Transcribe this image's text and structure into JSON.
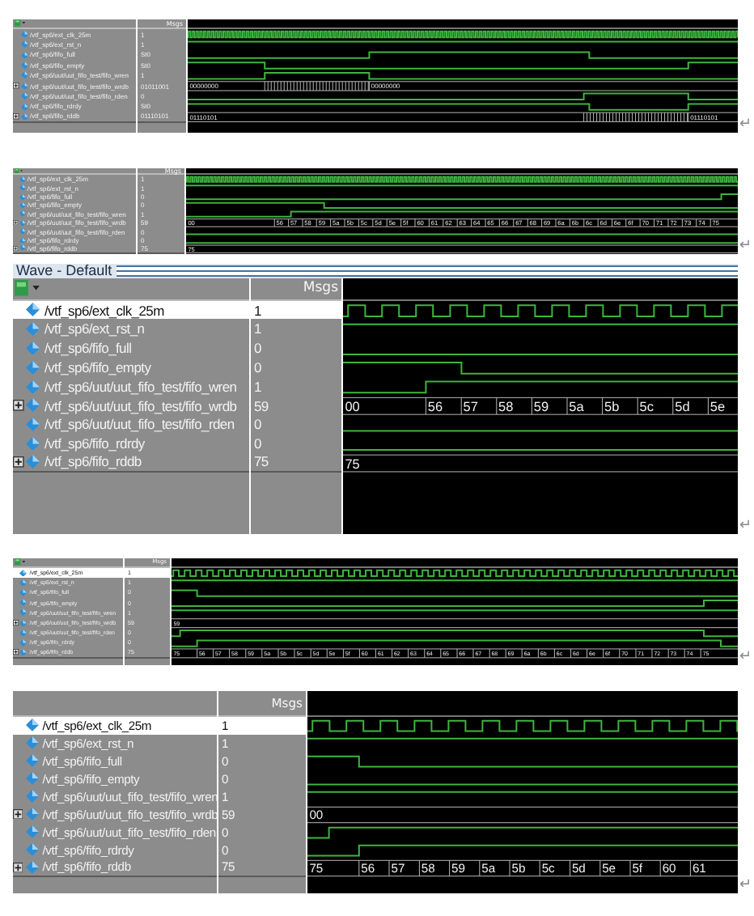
{
  "panels": [
    {
      "msgs_header": "Msgs",
      "paragraph_mark": "↵",
      "signals": [
        {
          "name": "/vtf_sp6/ext_clk_25m",
          "value": "1",
          "kind": "clock",
          "selected": false
        },
        {
          "name": "/vtf_sp6/ext_rst_n",
          "value": "1",
          "kind": "level",
          "selected": false
        },
        {
          "name": "/vtf_sp6/fifo_full",
          "value": "St0",
          "kind": "level",
          "selected": false
        },
        {
          "name": "/vtf_sp6/fifo_empty",
          "value": "St0",
          "kind": "level",
          "selected": false
        },
        {
          "name": "/vtf_sp6/uut/uut_fifo_test/fifo_wren",
          "value": "1",
          "kind": "level",
          "selected": false
        },
        {
          "name": "/vtf_sp6/uut/uut_fifo_test/fifo_wrdb",
          "value": "01011001",
          "kind": "bus",
          "selected": false,
          "bus_values": [
            "00000000",
            "00000000"
          ]
        },
        {
          "name": "/vtf_sp6/uut/uut_fifo_test/fifo_rden",
          "value": "0",
          "kind": "level",
          "selected": false
        },
        {
          "name": "/vtf_sp6/fifo_rdrdy",
          "value": "St0",
          "kind": "level",
          "selected": false
        },
        {
          "name": "/vtf_sp6/fifo_rddb",
          "value": "01110101",
          "kind": "bus",
          "selected": false,
          "bus_values": [
            "01110101",
            "01110101"
          ]
        }
      ]
    },
    {
      "msgs_header": "Msgs",
      "paragraph_mark": "↵",
      "signals": [
        {
          "name": "/vtf_sp6/ext_clk_25m",
          "value": "1",
          "kind": "clock",
          "selected": false
        },
        {
          "name": "/vtf_sp6/ext_rst_n",
          "value": "1",
          "kind": "level",
          "selected": false
        },
        {
          "name": "/vtf_sp6/fifo_full",
          "value": "0",
          "kind": "level",
          "selected": false
        },
        {
          "name": "/vtf_sp6/fifo_empty",
          "value": "0",
          "kind": "level",
          "selected": false
        },
        {
          "name": "/vtf_sp6/uut/uut_fifo_test/fifo_wren",
          "value": "1",
          "kind": "level",
          "selected": false
        },
        {
          "name": "/vtf_sp6/uut/uut_fifo_test/fifo_wrdb",
          "value": "59",
          "kind": "bus",
          "selected": false,
          "bus_values": [
            "00",
            "56",
            "57",
            "58",
            "59",
            "5a",
            "5b",
            "5c",
            "5d",
            "5e",
            "5f",
            "60",
            "61",
            "62",
            "63",
            "64",
            "65",
            "66",
            "67",
            "68",
            "69",
            "6a",
            "6b",
            "6c",
            "6d",
            "6e",
            "6f",
            "70",
            "71",
            "72",
            "73",
            "74",
            "75"
          ]
        },
        {
          "name": "/vtf_sp6/uut/uut_fifo_test/fifo_rden",
          "value": "0",
          "kind": "level",
          "selected": false
        },
        {
          "name": "/vtf_sp6/fifo_rdrdy",
          "value": "0",
          "kind": "level",
          "selected": false
        },
        {
          "name": "/vtf_sp6/fifo_rddb",
          "value": "75",
          "kind": "bus",
          "selected": false,
          "bus_values": [
            "75"
          ]
        }
      ]
    },
    {
      "title": "Wave - Default",
      "msgs_header": "Msgs",
      "paragraph_mark": "↵",
      "signals": [
        {
          "name": "/vtf_sp6/ext_clk_25m",
          "value": "1",
          "kind": "clock",
          "selected": true
        },
        {
          "name": "/vtf_sp6/ext_rst_n",
          "value": "1",
          "kind": "level",
          "selected": false
        },
        {
          "name": "/vtf_sp6/fifo_full",
          "value": "0",
          "kind": "level",
          "selected": false
        },
        {
          "name": "/vtf_sp6/fifo_empty",
          "value": "0",
          "kind": "level",
          "selected": false
        },
        {
          "name": "/vtf_sp6/uut/uut_fifo_test/fifo_wren",
          "value": "1",
          "kind": "level",
          "selected": false
        },
        {
          "name": "/vtf_sp6/uut/uut_fifo_test/fifo_wrdb",
          "value": "59",
          "kind": "bus",
          "selected": false,
          "bus_values": [
            "00",
            "56",
            "57",
            "58",
            "59",
            "5a",
            "5b",
            "5c",
            "5d",
            "5e"
          ]
        },
        {
          "name": "/vtf_sp6/uut/uut_fifo_test/fifo_rden",
          "value": "0",
          "kind": "level",
          "selected": false
        },
        {
          "name": "/vtf_sp6/fifo_rdrdy",
          "value": "0",
          "kind": "level",
          "selected": false
        },
        {
          "name": "/vtf_sp6/fifo_rddb",
          "value": "75",
          "kind": "bus",
          "selected": false,
          "bus_values": [
            "75"
          ]
        }
      ]
    },
    {
      "msgs_header": "Msgs",
      "paragraph_mark": "↵",
      "signals": [
        {
          "name": "/vtf_sp6/ext_clk_25m",
          "value": "1",
          "kind": "clock",
          "selected": true
        },
        {
          "name": "/vtf_sp6/ext_rst_n",
          "value": "1",
          "kind": "level",
          "selected": false
        },
        {
          "name": "/vtf_sp6/fifo_full",
          "value": "0",
          "kind": "level",
          "selected": false
        },
        {
          "name": "/vtf_sp6/fifo_empty",
          "value": "0",
          "kind": "level",
          "selected": false
        },
        {
          "name": "/vtf_sp6/uut/uut_fifo_test/fifo_wren",
          "value": "1",
          "kind": "level",
          "selected": false
        },
        {
          "name": "/vtf_sp6/uut/uut_fifo_test/fifo_wrdb",
          "value": "59",
          "kind": "bus",
          "selected": false,
          "bus_values": [
            "59"
          ]
        },
        {
          "name": "/vtf_sp6/uut/uut_fifo_test/fifo_rden",
          "value": "0",
          "kind": "level",
          "selected": false
        },
        {
          "name": "/vtf_sp6/fifo_rdrdy",
          "value": "0",
          "kind": "level",
          "selected": false
        },
        {
          "name": "/vtf_sp6/fifo_rddb",
          "value": "75",
          "kind": "bus",
          "selected": false,
          "bus_values": [
            "75",
            "56",
            "57",
            "58",
            "59",
            "5a",
            "5b",
            "5c",
            "5d",
            "5e",
            "5f",
            "60",
            "61",
            "62",
            "63",
            "64",
            "65",
            "66",
            "67",
            "68",
            "69",
            "6a",
            "6b",
            "6c",
            "6d",
            "6e",
            "6f",
            "70",
            "71",
            "72",
            "73",
            "74",
            "75"
          ]
        }
      ]
    },
    {
      "msgs_header": "Msgs",
      "paragraph_mark": "↵",
      "signals": [
        {
          "name": "/vtf_sp6/ext_clk_25m",
          "value": "1",
          "kind": "clock",
          "selected": true
        },
        {
          "name": "/vtf_sp6/ext_rst_n",
          "value": "1",
          "kind": "level",
          "selected": false
        },
        {
          "name": "/vtf_sp6/fifo_full",
          "value": "0",
          "kind": "level",
          "selected": false
        },
        {
          "name": "/vtf_sp6/fifo_empty",
          "value": "0",
          "kind": "level",
          "selected": false
        },
        {
          "name": "/vtf_sp6/uut/uut_fifo_test/fifo_wren",
          "value": "1",
          "kind": "level",
          "selected": false
        },
        {
          "name": "/vtf_sp6/uut/uut_fifo_test/fifo_wrdb",
          "value": "59",
          "kind": "bus",
          "selected": false,
          "bus_values": [
            "00"
          ]
        },
        {
          "name": "/vtf_sp6/uut/uut_fifo_test/fifo_rden",
          "value": "0",
          "kind": "level",
          "selected": false
        },
        {
          "name": "/vtf_sp6/fifo_rdrdy",
          "value": "0",
          "kind": "level",
          "selected": false
        },
        {
          "name": "/vtf_sp6/fifo_rddb",
          "value": "75",
          "kind": "bus",
          "selected": false,
          "bus_values": [
            "75",
            "56",
            "57",
            "58",
            "59",
            "5a",
            "5b",
            "5c",
            "5d",
            "5e",
            "5f",
            "60",
            "61"
          ]
        }
      ]
    }
  ]
}
